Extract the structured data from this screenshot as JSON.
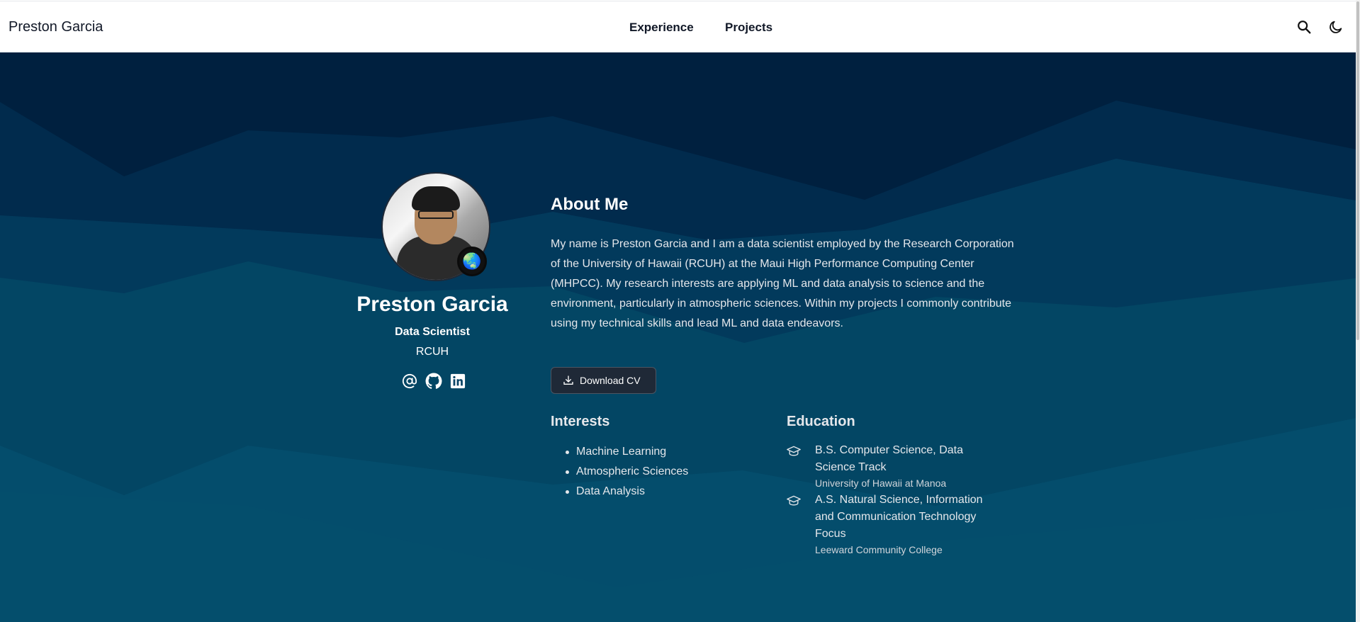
{
  "nav": {
    "brand": "Preston Garcia",
    "links": [
      {
        "label": "Experience"
      },
      {
        "label": "Projects"
      }
    ],
    "icons": [
      "search-icon",
      "moon-icon"
    ]
  },
  "colors": {
    "hero_dark": "#00203f",
    "hero_mid": "#023a5c",
    "hero_light": "#044d6c",
    "text": "#ffffff"
  },
  "profile": {
    "name": "Preston Garcia",
    "role": "Data Scientist",
    "organization": "RCUH",
    "badge_icon": "globe-icon",
    "social_icons": [
      "at-icon",
      "github-icon",
      "linkedin-icon"
    ]
  },
  "about": {
    "title": "About Me",
    "text": "My name is Preston Garcia and I am a data scientist employed by the Research Corporation of the University of Hawaii (RCUH) at the Maui High Performance Computing Center (MHPCC). My research interests are applying ML and data analysis to science and the environment, particularly in atmospheric sciences. Within my projects I commonly contribute using my technical skills and lead ML and data endeavors.",
    "cv_button": "Download CV"
  },
  "interests": {
    "title": "Interests",
    "items": [
      "Machine Learning",
      "Atmospheric Sciences",
      "Data Analysis"
    ]
  },
  "education": {
    "title": "Education",
    "items": [
      {
        "degree": "B.S. Computer Science, Data Science Track",
        "school": "University of Hawaii at Manoa"
      },
      {
        "degree": "A.S. Natural Science, Information and Communication Technology Focus",
        "school": "Leeward Community College"
      }
    ]
  }
}
